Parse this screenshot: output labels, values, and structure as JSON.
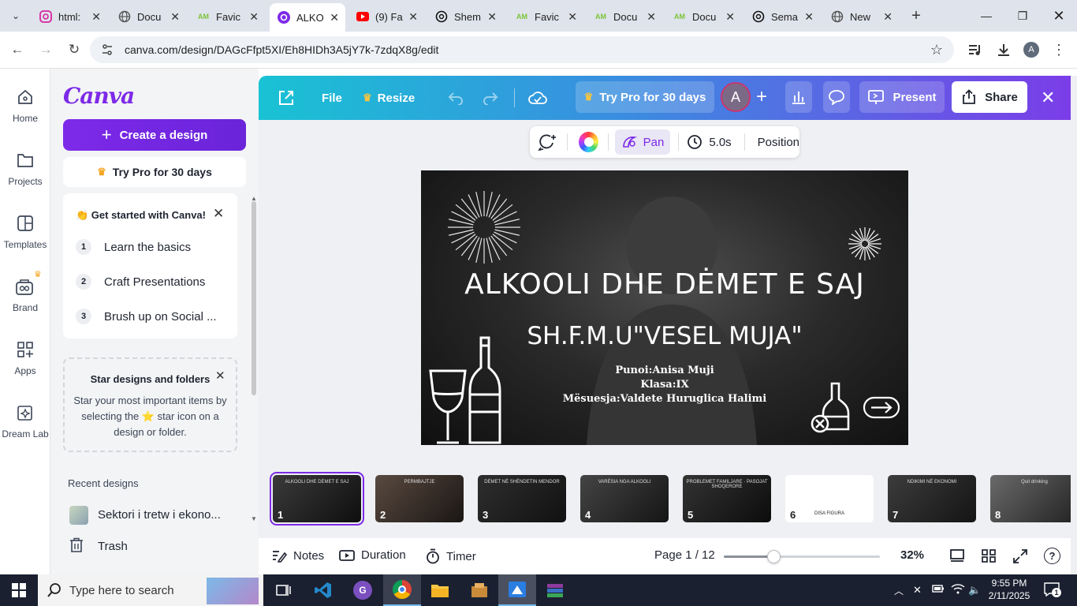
{
  "browser": {
    "tabs": [
      {
        "title": "html:",
        "icon": "instagram-icon",
        "color": "#d6249f"
      },
      {
        "title": "Docu",
        "icon": "globe-icon",
        "color": "#555555"
      },
      {
        "title": "Favic",
        "icon": "am-icon",
        "color": "#7cc43a"
      },
      {
        "title": "ALKO",
        "icon": "canva-icon",
        "color": "#7d2ae8"
      },
      {
        "title": "(9) Fa",
        "icon": "youtube-icon",
        "color": "#ff0000"
      },
      {
        "title": "Shem",
        "icon": "chatgpt-icon",
        "color": "#111111"
      },
      {
        "title": "Favic",
        "icon": "am-icon",
        "color": "#7cc43a"
      },
      {
        "title": "Docu",
        "icon": "am-icon",
        "color": "#7cc43a"
      },
      {
        "title": "Docu",
        "icon": "am-icon",
        "color": "#7cc43a"
      },
      {
        "title": "Sema",
        "icon": "chatgpt-icon",
        "color": "#111111"
      },
      {
        "title": "New",
        "icon": "chrome-icon",
        "color": "#555555"
      }
    ],
    "url": "canva.com/design/DAGcFfpt5XI/Eh8HIDh3A5jY7k-7zdqX8g/edit",
    "profile_initial": "A"
  },
  "rail": {
    "home": "Home",
    "projects": "Projects",
    "templates": "Templates",
    "brand": "Brand",
    "apps": "Apps",
    "dreamlab": "Dream Lab"
  },
  "panel": {
    "logo": "Canva",
    "create": "Create a design",
    "try_pro": "Try Pro for 30 days",
    "get_started_title": "👏 Get started with Canva!",
    "steps": [
      {
        "num": "1",
        "label": "Learn the basics"
      },
      {
        "num": "2",
        "label": "Craft Presentations"
      },
      {
        "num": "3",
        "label": "Brush up on Social ..."
      }
    ],
    "star_title": "Star designs and folders",
    "star_text_1": "Star your most important items by",
    "star_text_2": "selecting the ⭐ star icon on a",
    "star_text_3": "design or folder.",
    "recent_label": "Recent designs",
    "recent_item": "Sektori i tretw i ekono...",
    "trash": "Trash"
  },
  "toolbar": {
    "file": "File",
    "resize": "Resize",
    "try_pro": "Try Pro for 30 days",
    "avatar": "A",
    "present": "Present",
    "share": "Share"
  },
  "context": {
    "pan": "Pan",
    "duration": "5.0s",
    "position": "Position"
  },
  "slide": {
    "title": "ALKOOLI DHE DĖMET E SAJ",
    "school": "SH.F.M.U\"VESEL MUJA\"",
    "line1": "Punoi:Anisa Muji",
    "line2": "Klasa:IX",
    "line3": "Mësuesja:Valdete Huruglica Halimi"
  },
  "thumbnails": [
    {
      "num": "1",
      "caption": "ALKOOLI DHE DĖMET E SAJ"
    },
    {
      "num": "2",
      "caption": "PERMBAJTJE"
    },
    {
      "num": "3",
      "caption": "DĖMET NË SHËNDETIN MENDOR"
    },
    {
      "num": "4",
      "caption": "VARËSIA NGA ALKOOLI"
    },
    {
      "num": "5",
      "caption": "PROBLEMET FAMILJARE · PASOJAT SHOQERORE"
    },
    {
      "num": "6",
      "caption": "DISA FIGURA"
    },
    {
      "num": "7",
      "caption": "NDIKIMI NË EKONOMI"
    },
    {
      "num": "8",
      "caption": "Quit drinking"
    }
  ],
  "bottom": {
    "notes": "Notes",
    "duration": "Duration",
    "timer": "Timer",
    "page": "Page 1 / 12",
    "zoom": "32%",
    "zoom_level": 0.32
  },
  "taskbar": {
    "search_placeholder": "Type here to search",
    "time": "9:55 PM",
    "date": "2/11/2025",
    "notifications": "1"
  }
}
